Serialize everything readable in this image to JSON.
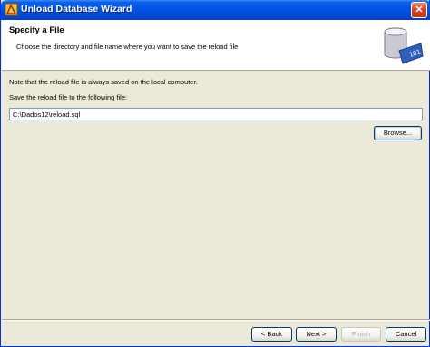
{
  "window": {
    "title": "Unload Database Wizard"
  },
  "header": {
    "title": "Specify a File",
    "description": "Choose the directory and file name where you want to save the reload file."
  },
  "content": {
    "note": "Note that the reload file is always saved on the local computer.",
    "field_label": "Save the reload file to the following file:",
    "file_value": "C:\\Dados12\\reload.sql",
    "browse_label": "Browse..."
  },
  "footer": {
    "back_label": "< Back",
    "next_label": "Next >",
    "finish_label": "Finish",
    "cancel_label": "Cancel"
  },
  "colors": {
    "titlebar": "#0054e3",
    "face": "#ece9d8",
    "disabled_text": "#aca899"
  },
  "icons": {
    "title": "wizard-app-icon",
    "header": "database-file-icon",
    "close": "close-icon"
  }
}
